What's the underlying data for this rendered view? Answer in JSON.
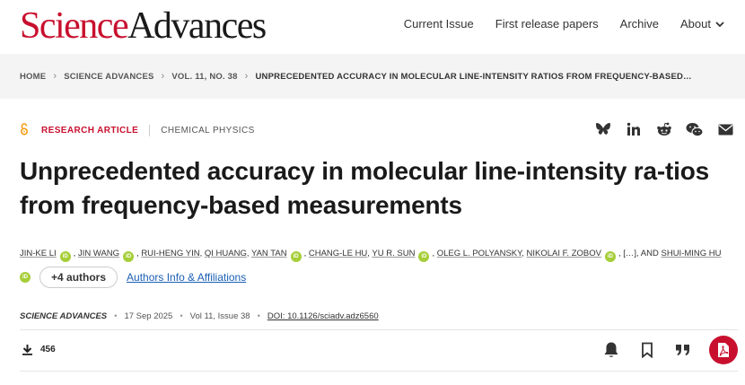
{
  "logo": {
    "science": "Science",
    "advances": "Advances"
  },
  "nav": {
    "current_issue": "Current Issue",
    "first_release": "First release papers",
    "archive": "Archive",
    "about": "About"
  },
  "breadcrumb": {
    "items": [
      "HOME",
      "SCIENCE ADVANCES",
      "VOL. 11, NO. 38"
    ],
    "current": "UNPRECEDENTED ACCURACY IN MOLECULAR LINE-INTENSITY RATIOS FROM FREQUENCY-BASED…"
  },
  "article": {
    "type": "RESEARCH ARTICLE",
    "subject": "CHEMICAL PHYSICS",
    "title": "Unprecedented accuracy in molecular line-intensity ra-tios from frequency-based measurements",
    "authors": [
      "JIN-KE LI",
      "JIN WANG",
      "RUI-HENG YIN",
      "QI HUANG",
      "YAN TAN",
      "CHANG-LE HU",
      "YU R. SUN",
      "OLEG L. POLYANSKY",
      "NIKOLAI F. ZOBOV",
      "SHUI-MING HU"
    ],
    "ellipsis": "[…]",
    "and": "AND",
    "orcid_label": "iD",
    "more_authors": "+4 authors",
    "affiliations_link": "Authors Info & Affiliations"
  },
  "meta": {
    "journal": "SCIENCE ADVANCES",
    "date": "17 Sep 2025",
    "issue": "Vol 11, Issue 38",
    "doi": "DOI: 10.1126/sciadv.adz6560"
  },
  "toolbar": {
    "downloads": "456"
  },
  "colors": {
    "brand_red": "#c8102e",
    "orcid_green": "#a6ce39",
    "link_blue": "#1a5fb4",
    "open_access": "#f39c12"
  },
  "icons": [
    "open-access-icon",
    "bluesky-icon",
    "linkedin-icon",
    "reddit-icon",
    "wechat-icon",
    "email-icon",
    "download-icon",
    "bell-icon",
    "bookmark-icon",
    "quote-icon",
    "pdf-icon",
    "chevron-down-icon"
  ]
}
